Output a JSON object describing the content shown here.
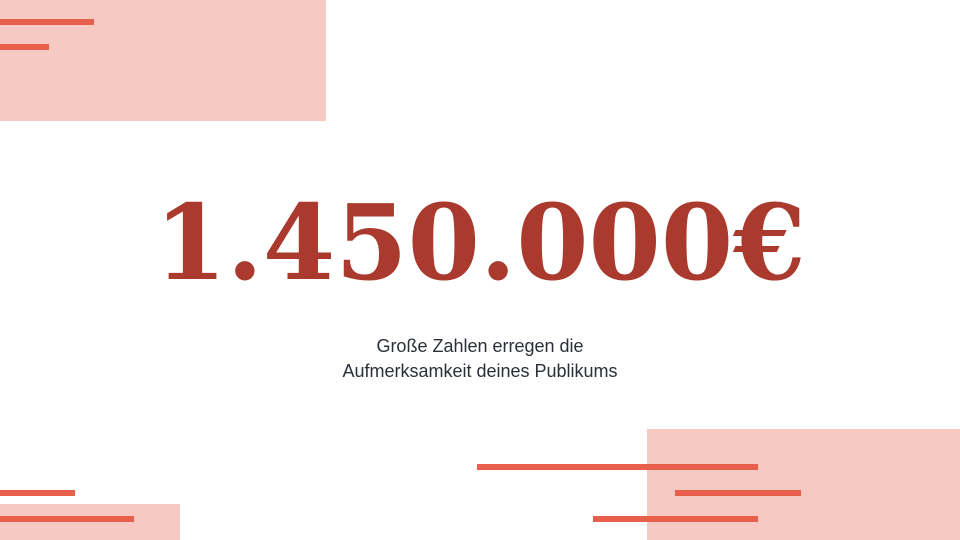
{
  "slide": {
    "headline_number": "1.450.000€",
    "subtitle_line1": "Große Zahlen erregen die",
    "subtitle_line2": "Aufmerksamkeit deines Publikums"
  },
  "colors": {
    "accent_dark": "#ab3a2e",
    "accent_bar": "#e8604b",
    "accent_block": "#f6c9c3",
    "text": "#2a2f38",
    "background": "#ffffff"
  }
}
